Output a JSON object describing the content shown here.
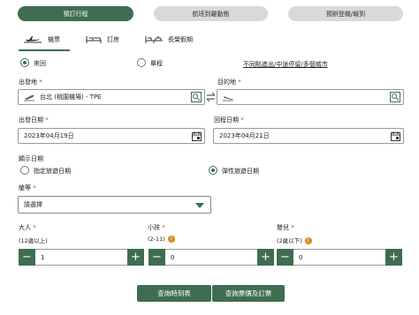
{
  "tabs": [
    "預訂行程",
    "航班到離動態",
    "預辦登機/報到"
  ],
  "modes": [
    "機票",
    "訂房",
    "長榮假期"
  ],
  "trip_type": {
    "round": "來回",
    "oneway": "單程",
    "multi_link": "不同點進出/中途停留/多個城市"
  },
  "origin": {
    "label": "出發地",
    "value": "台北 (桃園機場) - TPE"
  },
  "destination": {
    "label": "目的地",
    "value": ""
  },
  "depart_date": {
    "label": "出發日期",
    "value": "2023年04月19日"
  },
  "return_date": {
    "label": "回程日期",
    "value": "2023年04月21日"
  },
  "display_date": {
    "label": "顯示日期",
    "specific": "指定旅遊日期",
    "flexible": "彈性旅遊日期"
  },
  "cabin": {
    "label": "艙等",
    "value": "請選擇"
  },
  "passengers": {
    "adult": {
      "label": "大人",
      "sub": "(12歲以上)",
      "value": "1"
    },
    "child": {
      "label": "小孩",
      "sub": "(2-11)",
      "value": "0"
    },
    "infant": {
      "label": "嬰兒",
      "sub": "(2歲以下)",
      "value": "0"
    }
  },
  "required_mark": "*",
  "actions": {
    "schedule": "查詢時刻表",
    "fares": "查詢票價及訂票"
  },
  "colors": {
    "brand": "#3f6d52",
    "info": "#e08a1e",
    "required": "#c0392b"
  }
}
